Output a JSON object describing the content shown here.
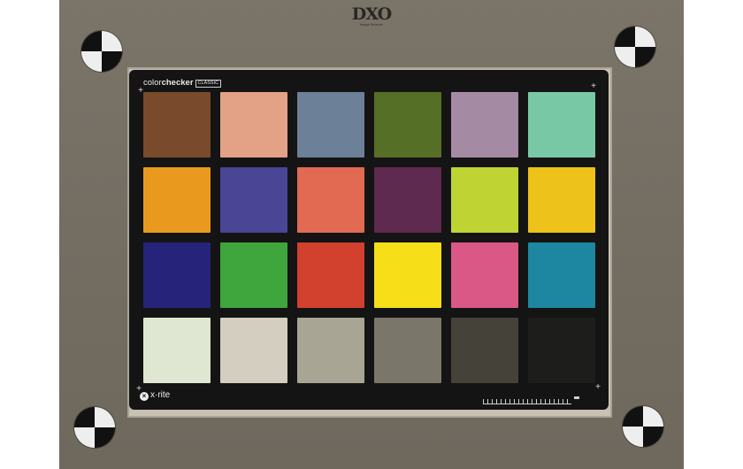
{
  "logo": {
    "mark": "DXO",
    "subtitle": "Image Science"
  },
  "card": {
    "brand_light": "color",
    "brand_bold": "checker",
    "brand_badge": "CLASSIC",
    "maker": "x·rite",
    "maker_mark": "×"
  },
  "registration_targets": [
    "top-left",
    "top-right",
    "bottom-left",
    "bottom-right"
  ],
  "patches": [
    "#7a4a2c",
    "#e3a285",
    "#6c8197",
    "#566f26",
    "#a58aa3",
    "#79c8a5",
    "#e99a1e",
    "#4a4595",
    "#e26a53",
    "#5e2a4f",
    "#bfd433",
    "#edc21a",
    "#26237b",
    "#3ea63c",
    "#d2412d",
    "#f6df19",
    "#d95886",
    "#1d86a0",
    "#dfe6d1",
    "#d3cebf",
    "#a9a595",
    "#7a766a",
    "#45423a",
    "#1d1d1c"
  ]
}
